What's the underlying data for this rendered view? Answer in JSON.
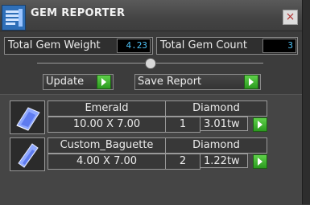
{
  "window": {
    "title": "GEM REPORTER",
    "close_glyph": "×"
  },
  "totals": {
    "weight_label": "Total Gem Weight",
    "weight_value": "4.23",
    "count_label": "Total Gem Count",
    "count_value": "3"
  },
  "actions": {
    "update_label": "Update",
    "save_label": "Save Report"
  },
  "gems": [
    {
      "name": "Emerald",
      "material": "Diamond",
      "size": "10.00 X 7.00",
      "qty": "1",
      "weight": "3.01tw",
      "icon": "emerald-gem-icon"
    },
    {
      "name": "Custom_Baguette",
      "material": "Diamond",
      "size": "4.00 X 7.00",
      "qty": "2",
      "weight": "1.22tw",
      "icon": "baguette-gem-icon"
    }
  ],
  "colors": {
    "accent_value_text": "#4fc3f7",
    "go_button": "#3cb82a",
    "close_x": "#b03030"
  }
}
